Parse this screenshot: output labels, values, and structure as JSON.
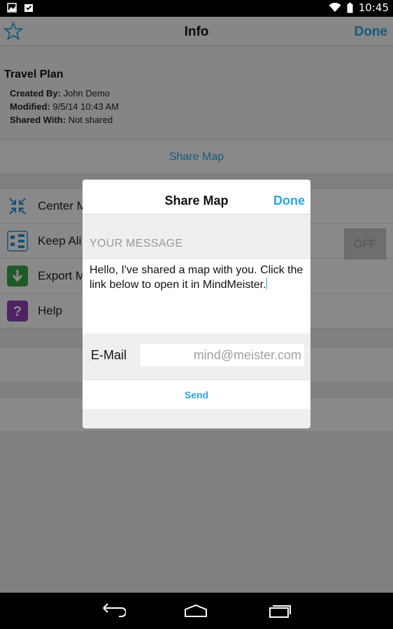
{
  "status_bar": {
    "time": "10:45"
  },
  "header": {
    "title": "Info",
    "done_label": "Done"
  },
  "info": {
    "map_name": "Travel Plan",
    "created_by_label": "Created By:",
    "created_by_value": "John Demo",
    "modified_label": "Modified:",
    "modified_value": "9/5/14 10:43 AM",
    "shared_with_label": "Shared With:",
    "shared_with_value": "Not shared"
  },
  "share_map_label": "Share Map",
  "list": {
    "items": [
      {
        "label": "Center M",
        "icon": "center-icon"
      },
      {
        "label": "Keep Ali",
        "icon": "layout-icon"
      },
      {
        "label": "Export M",
        "icon": "export-icon"
      },
      {
        "label": "Help",
        "icon": "help-icon"
      }
    ],
    "toggle_label": "OFF"
  },
  "dialog": {
    "title": "Share Map",
    "done_label": "Done",
    "message_label": "YOUR MESSAGE",
    "message_text": "Hello, I've shared a map with you. Click the link below to open it in MindMeister.",
    "email_label": "E-Mail",
    "email_placeholder": "mind@meister.com",
    "send_label": "Send"
  },
  "colors": {
    "accent": "#2aa6df"
  }
}
